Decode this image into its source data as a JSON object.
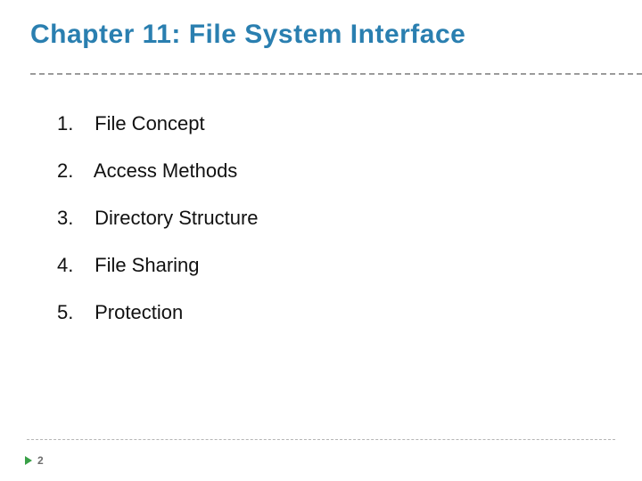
{
  "title": "Chapter 11:  File System Interface",
  "items": [
    {
      "num": "1.",
      "text": "File Concept"
    },
    {
      "num": "2.",
      "text": "Access Methods"
    },
    {
      "num": "3.",
      "text": "Directory Structure"
    },
    {
      "num": "4.",
      "text": "File Sharing"
    },
    {
      "num": "5.",
      "text": "Protection"
    }
  ],
  "page_number": "2"
}
